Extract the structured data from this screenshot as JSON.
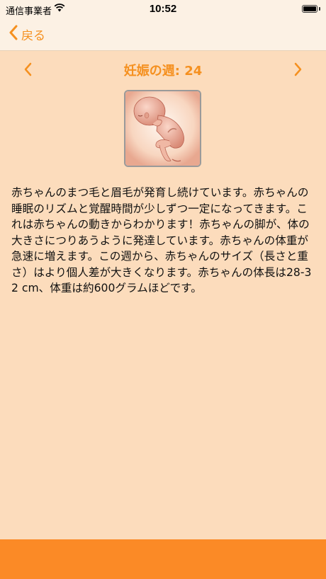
{
  "status_bar": {
    "carrier": "通信事業者",
    "time": "10:52",
    "wifi_icon": "wifi-icon",
    "battery_icon": "battery-icon"
  },
  "nav": {
    "back_label": "戻る",
    "back_icon": "chevron-left-icon"
  },
  "week": {
    "title": "妊娠の週: 24",
    "prev_icon": "chevron-left-icon",
    "next_icon": "chevron-right-icon"
  },
  "illustration": {
    "icon": "fetus-illustration"
  },
  "description": "赤ちゃんのまつ毛と眉毛が発育し続けています。赤ちゃんの睡眠のリズムと覚醒時間が少しずつ一定になってきます。これは赤ちゃんの動きからわかります！赤ちゃんの脚が、体の大きさにつりあうように発達しています。赤ちゃんの体重が急速に増えます。この週から、赤ちゃんのサイズ（長さと重さ）はより個人差が大きくなります。赤ちゃんの体長は28-32 cm、体重は約600グラムほどです。",
  "colors": {
    "accent": "#f5901f",
    "background": "#fcdcbc",
    "bar": "#fcf1e4",
    "bottom_bar": "#fb8a26"
  }
}
